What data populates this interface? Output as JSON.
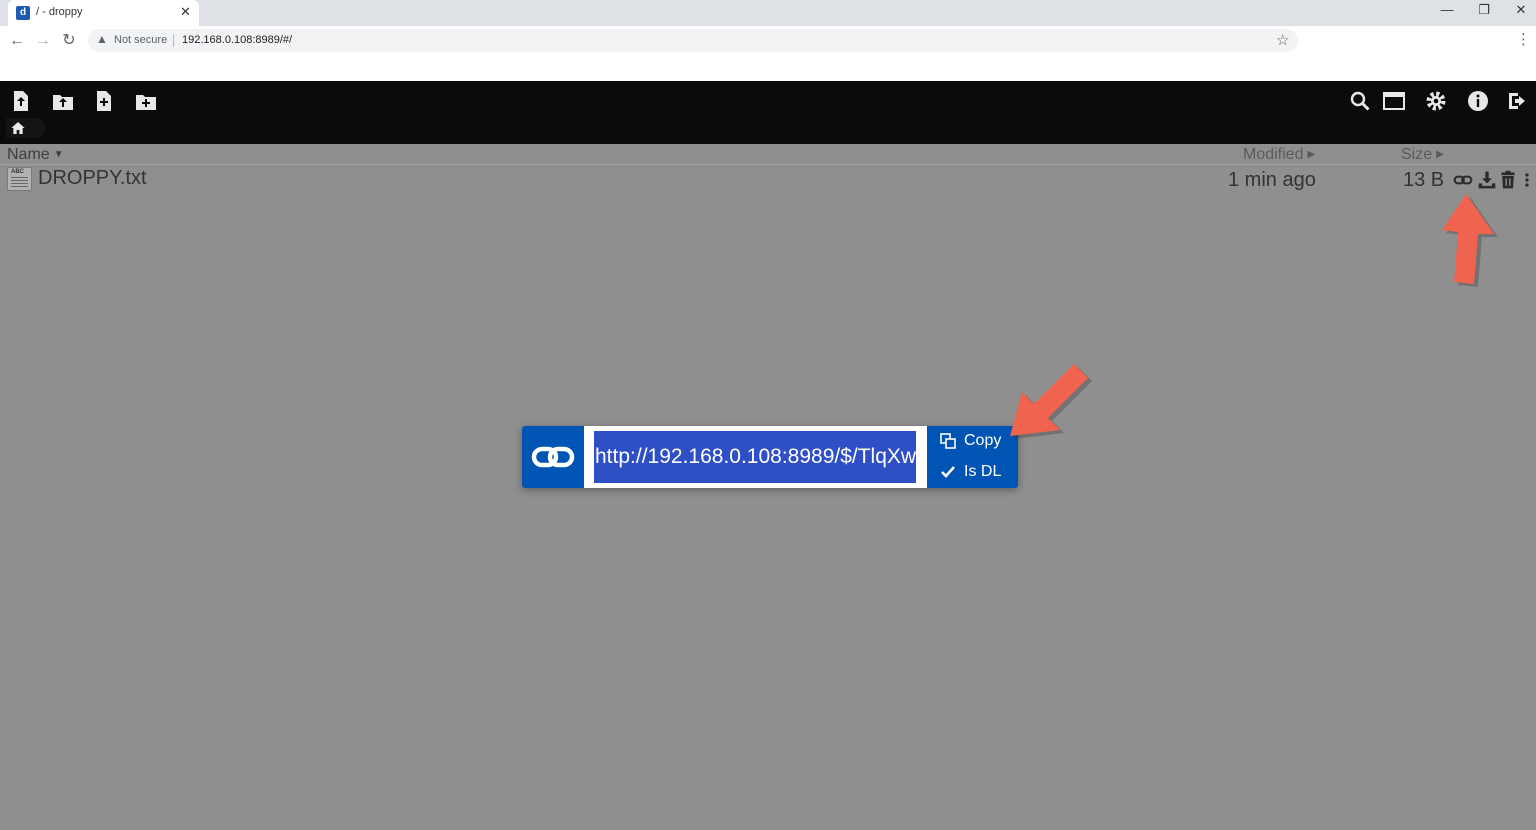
{
  "browser": {
    "tab_title": "/ - droppy",
    "tab_close": "✕",
    "security_label": "Not secure",
    "url": "192.168.0.108:8989/#/",
    "window_controls": [
      "—",
      "❐",
      "✕"
    ]
  },
  "header": {
    "icons": [
      "upload-file-icon",
      "upload-folder-icon",
      "new-file-icon",
      "new-folder-icon",
      "search-icon",
      "view-toggle-icon",
      "settings-icon",
      "info-icon",
      "logout-icon"
    ],
    "breadcrumb_home": "home-icon"
  },
  "file_list": {
    "columns": {
      "name": "Name",
      "modified": "Modified",
      "size": "Size"
    },
    "rows": [
      {
        "name": "DROPPY.txt",
        "modified": "1 min ago",
        "size": "13 B"
      }
    ]
  },
  "share_popup": {
    "link": "http://192.168.0.108:8989/$/TlqXw",
    "copy_label": "Copy",
    "is_dl_label": "Is DL"
  },
  "colors": {
    "app_header": "#0b0b0b",
    "list_background": "#8f8f8f",
    "share_accent": "#0054b4",
    "selection": "#2f4fc6",
    "annotation_arrow": "#f0634f"
  }
}
